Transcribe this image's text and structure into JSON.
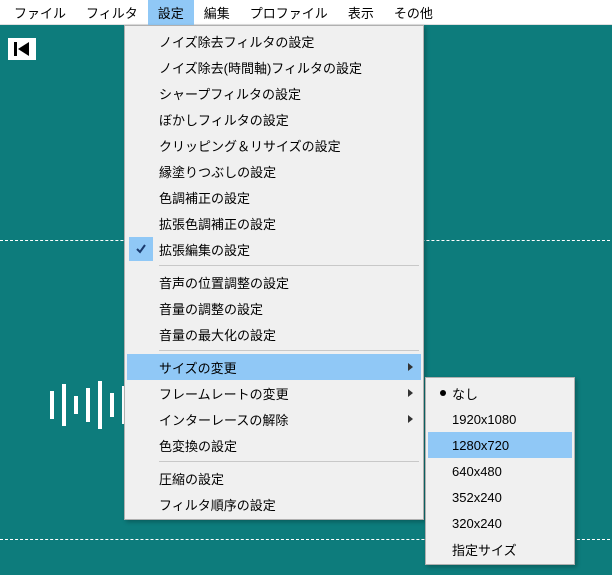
{
  "menubar": {
    "items": [
      {
        "label": "ファイル",
        "active": false
      },
      {
        "label": "フィルタ",
        "active": false
      },
      {
        "label": "設定",
        "active": true
      },
      {
        "label": "編集",
        "active": false
      },
      {
        "label": "プロファイル",
        "active": false
      },
      {
        "label": "表示",
        "active": false
      },
      {
        "label": "その他",
        "active": false
      }
    ]
  },
  "settings_menu": {
    "groups": [
      [
        {
          "label": "ノイズ除去フィルタの設定",
          "checked": false,
          "submenu": false
        },
        {
          "label": "ノイズ除去(時間軸)フィルタの設定",
          "checked": false,
          "submenu": false
        },
        {
          "label": "シャープフィルタの設定",
          "checked": false,
          "submenu": false
        },
        {
          "label": "ぼかしフィルタの設定",
          "checked": false,
          "submenu": false
        },
        {
          "label": "クリッピング＆リサイズの設定",
          "checked": false,
          "submenu": false
        },
        {
          "label": "縁塗りつぶしの設定",
          "checked": false,
          "submenu": false
        },
        {
          "label": "色調補正の設定",
          "checked": false,
          "submenu": false
        },
        {
          "label": "拡張色調補正の設定",
          "checked": false,
          "submenu": false
        },
        {
          "label": "拡張編集の設定",
          "checked": true,
          "submenu": false
        }
      ],
      [
        {
          "label": "音声の位置調整の設定",
          "checked": false,
          "submenu": false
        },
        {
          "label": "音量の調整の設定",
          "checked": false,
          "submenu": false
        },
        {
          "label": "音量の最大化の設定",
          "checked": false,
          "submenu": false
        }
      ],
      [
        {
          "label": "サイズの変更",
          "checked": false,
          "submenu": true,
          "highlight": true
        },
        {
          "label": "フレームレートの変更",
          "checked": false,
          "submenu": true
        },
        {
          "label": "インターレースの解除",
          "checked": false,
          "submenu": true
        },
        {
          "label": "色変換の設定",
          "checked": false,
          "submenu": false
        }
      ],
      [
        {
          "label": "圧縮の設定",
          "checked": false,
          "submenu": false
        },
        {
          "label": "フィルタ順序の設定",
          "checked": false,
          "submenu": false
        }
      ]
    ]
  },
  "size_submenu": {
    "items": [
      {
        "label": "なし",
        "selected": true,
        "highlight": false
      },
      {
        "label": "1920x1080",
        "selected": false,
        "highlight": false
      },
      {
        "label": "1280x720",
        "selected": false,
        "highlight": true
      },
      {
        "label": "640x480",
        "selected": false,
        "highlight": false
      },
      {
        "label": "352x240",
        "selected": false,
        "highlight": false
      },
      {
        "label": "320x240",
        "selected": false,
        "highlight": false
      },
      {
        "label": "指定サイズ",
        "selected": false,
        "highlight": false
      }
    ]
  },
  "icons": {
    "seek_start": "|◀"
  }
}
